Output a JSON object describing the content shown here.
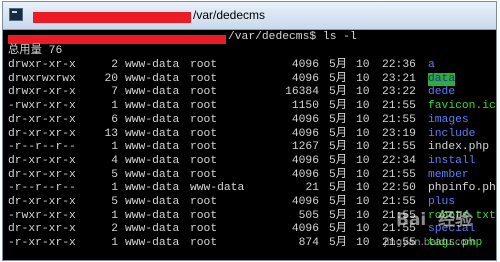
{
  "window": {
    "title_path": "/var/dedecms",
    "prompt_path": "/var/dedecms",
    "prompt_suffix": "$ ",
    "command": "ls -l"
  },
  "total_line": "总用量 76",
  "listing": [
    {
      "perms": "drwxr-xr-x",
      "links": "2",
      "owner": "www-data",
      "group": "root",
      "size": "4096",
      "month": "5月",
      "day": "10",
      "time": "22:36",
      "name": "a",
      "type": "dir"
    },
    {
      "perms": "drwxrwxrwx",
      "links": "20",
      "owner": "www-data",
      "group": "root",
      "size": "4096",
      "month": "5月",
      "day": "10",
      "time": "23:21",
      "name": "data",
      "type": "dir-highlight"
    },
    {
      "perms": "drwxr-xr-x",
      "links": "7",
      "owner": "www-data",
      "group": "root",
      "size": "16384",
      "month": "5月",
      "day": "10",
      "time": "23:22",
      "name": "dede",
      "type": "dir"
    },
    {
      "perms": "-rwxr-xr-x",
      "links": "1",
      "owner": "www-data",
      "group": "root",
      "size": "1150",
      "month": "5月",
      "day": "10",
      "time": "21:55",
      "name": "favicon.ico",
      "type": "exec"
    },
    {
      "perms": "dr-xr-xr-x",
      "links": "6",
      "owner": "www-data",
      "group": "root",
      "size": "4096",
      "month": "5月",
      "day": "10",
      "time": "21:55",
      "name": "images",
      "type": "dir"
    },
    {
      "perms": "dr-xr-xr-x",
      "links": "13",
      "owner": "www-data",
      "group": "root",
      "size": "4096",
      "month": "5月",
      "day": "10",
      "time": "23:19",
      "name": "include",
      "type": "dir"
    },
    {
      "perms": "-r--r--r--",
      "links": "1",
      "owner": "www-data",
      "group": "root",
      "size": "1267",
      "month": "5月",
      "day": "10",
      "time": "21:55",
      "name": "index.php",
      "type": "plain"
    },
    {
      "perms": "dr-xr-xr-x",
      "links": "4",
      "owner": "www-data",
      "group": "root",
      "size": "4096",
      "month": "5月",
      "day": "10",
      "time": "22:34",
      "name": "install",
      "type": "dir"
    },
    {
      "perms": "dr-xr-xr-x",
      "links": "5",
      "owner": "www-data",
      "group": "root",
      "size": "4096",
      "month": "5月",
      "day": "10",
      "time": "21:55",
      "name": "member",
      "type": "dir"
    },
    {
      "perms": "-r--r--r--",
      "links": "1",
      "owner": "www-data",
      "group": "www-data",
      "size": "21",
      "month": "5月",
      "day": "10",
      "time": "22:50",
      "name": "phpinfo.php",
      "type": "plain"
    },
    {
      "perms": "dr-xr-xr-x",
      "links": "5",
      "owner": "www-data",
      "group": "root",
      "size": "4096",
      "month": "5月",
      "day": "10",
      "time": "21:55",
      "name": "plus",
      "type": "dir"
    },
    {
      "perms": "-rwxr-xr-x",
      "links": "1",
      "owner": "www-data",
      "group": "root",
      "size": "505",
      "month": "5月",
      "day": "10",
      "time": "21:55",
      "name": "robots.txt",
      "type": "exec"
    },
    {
      "perms": "dr-xr-xr-x",
      "links": "2",
      "owner": "www-data",
      "group": "root",
      "size": "4096",
      "month": "5月",
      "day": "10",
      "time": "21:55",
      "name": "special",
      "type": "dir"
    },
    {
      "perms": "-r-xr-xr-x",
      "links": "1",
      "owner": "www-data",
      "group": "root",
      "size": "874",
      "month": "5月",
      "day": "10",
      "time": "21:55",
      "name": "tags.php",
      "type": "exec"
    }
  ],
  "watermark": {
    "brand": "Bai  经验",
    "url": "jingyan.baidu.com"
  },
  "colors": {
    "redaction": "#ec1c24",
    "directory": "#5c7cff",
    "executable": "#33dd33",
    "highlight_bg": "#2fae2f",
    "terminal_bg": "#000000",
    "terminal_fg": "#d4d4d4"
  }
}
